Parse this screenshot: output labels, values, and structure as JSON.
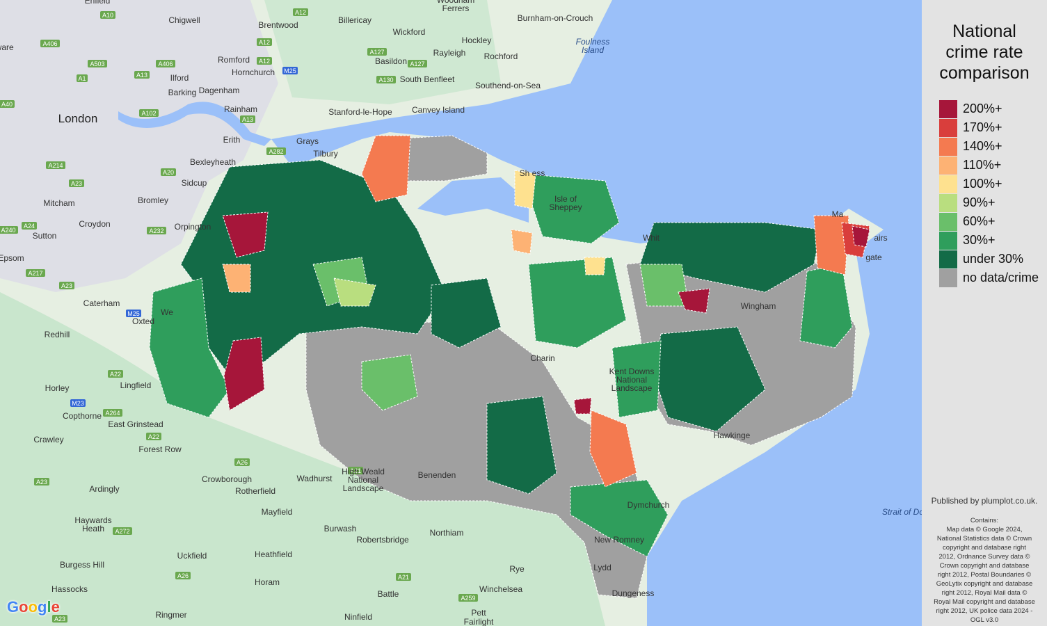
{
  "map": {
    "colors": {
      "land_base": "#e6efe2",
      "urban": "#dcdde3",
      "green_space": "#bfe2c4",
      "water": "#9bc0f9",
      "district_border": "#ffffff"
    },
    "places": [
      {
        "id": "enfield",
        "label": "Enfield"
      },
      {
        "id": "edgware",
        "label": "dgware"
      },
      {
        "id": "chigwell",
        "label": "Chigwell"
      },
      {
        "id": "brentwood",
        "label": "Brentwood"
      },
      {
        "id": "billericay",
        "label": "Billericay"
      },
      {
        "id": "wickford",
        "label": "Wickford"
      },
      {
        "id": "woodham-ferrers",
        "label": "Woodham\nFerrers"
      },
      {
        "id": "burnham",
        "label": "Burnham-on-Crouch"
      },
      {
        "id": "hockley",
        "label": "Hockley"
      },
      {
        "id": "rayleigh",
        "label": "Rayleigh"
      },
      {
        "id": "rochford",
        "label": "Rochford"
      },
      {
        "id": "foulness",
        "label": "Foulness\nIsland"
      },
      {
        "id": "romford",
        "label": "Romford"
      },
      {
        "id": "hornchurch",
        "label": "Hornchurch"
      },
      {
        "id": "basildon",
        "label": "Basildon"
      },
      {
        "id": "ilford",
        "label": "Ilford"
      },
      {
        "id": "barking",
        "label": "Barking"
      },
      {
        "id": "dagenham",
        "label": "Dagenham"
      },
      {
        "id": "south-benfleet",
        "label": "South Benfleet"
      },
      {
        "id": "southend",
        "label": "Southend-on-Sea"
      },
      {
        "id": "london",
        "label": "London"
      },
      {
        "id": "rainham",
        "label": "Rainham"
      },
      {
        "id": "stanford",
        "label": "Stanford-le-Hope"
      },
      {
        "id": "canvey",
        "label": "Canvey Island"
      },
      {
        "id": "erith",
        "label": "Erith"
      },
      {
        "id": "grays",
        "label": "Grays"
      },
      {
        "id": "tilbury",
        "label": "Tilbury"
      },
      {
        "id": "bexleyheath",
        "label": "Bexleyheath"
      },
      {
        "id": "sidcup",
        "label": "Sidcup"
      },
      {
        "id": "mitcham",
        "label": "Mitcham"
      },
      {
        "id": "bromley",
        "label": "Bromley"
      },
      {
        "id": "croydon",
        "label": "Croydon"
      },
      {
        "id": "orpington",
        "label": "Orpington"
      },
      {
        "id": "sutton",
        "label": "Sutton"
      },
      {
        "id": "epsom",
        "label": "Epsom"
      },
      {
        "id": "caterham",
        "label": "Caterham"
      },
      {
        "id": "westerham",
        "label": "We"
      },
      {
        "id": "oxted",
        "label": "Oxted"
      },
      {
        "id": "redhill",
        "label": "Redhill"
      },
      {
        "id": "horley",
        "label": "Horley"
      },
      {
        "id": "lingfield",
        "label": "Lingfield"
      },
      {
        "id": "copthorne",
        "label": "Copthorne"
      },
      {
        "id": "east-grinstead",
        "label": "East Grinstead"
      },
      {
        "id": "crawley",
        "label": "Crawley"
      },
      {
        "id": "forest-row",
        "label": "Forest Row"
      },
      {
        "id": "crowborough",
        "label": "Crowborough"
      },
      {
        "id": "wadhurst",
        "label": "Wadhurst"
      },
      {
        "id": "rotherfield",
        "label": "Rotherfield"
      },
      {
        "id": "ardingly",
        "label": "Ardingly"
      },
      {
        "id": "mayfield",
        "label": "Mayfield"
      },
      {
        "id": "haywards-heath",
        "label": "Haywards\nHeath"
      },
      {
        "id": "burwash",
        "label": "Burwash"
      },
      {
        "id": "robertsbridge",
        "label": "Robertsbridge"
      },
      {
        "id": "northiam",
        "label": "Northiam"
      },
      {
        "id": "uckfield",
        "label": "Uckfield"
      },
      {
        "id": "heathfield",
        "label": "Heathfield"
      },
      {
        "id": "burgess-hill",
        "label": "Burgess Hill"
      },
      {
        "id": "hassocks",
        "label": "Hassocks"
      },
      {
        "id": "horam",
        "label": "Horam"
      },
      {
        "id": "battle",
        "label": "Battle"
      },
      {
        "id": "rye",
        "label": "Rye"
      },
      {
        "id": "winchelsea",
        "label": "Winchelsea"
      },
      {
        "id": "ringmer",
        "label": "Ringmer"
      },
      {
        "id": "ninfield",
        "label": "Ninfield"
      },
      {
        "id": "pett",
        "label": "Pett"
      },
      {
        "id": "fairlight",
        "label": "Fairlight"
      },
      {
        "id": "lydd",
        "label": "Lydd"
      },
      {
        "id": "dungeness",
        "label": "Dungeness"
      },
      {
        "id": "new-romney",
        "label": "New Romney"
      },
      {
        "id": "dymchurch",
        "label": "Dymchurch"
      },
      {
        "id": "high-weald",
        "label": "High Weald\nNational\nLandscape"
      },
      {
        "id": "kent-downs",
        "label": "Kent Downs\nNational\nLandscape"
      },
      {
        "id": "strait",
        "label": "Strait of Do"
      },
      {
        "id": "sheerness",
        "label": "Sh    ess"
      },
      {
        "id": "isle-sheppey",
        "label": "Isle of\nSheppey"
      },
      {
        "id": "whitstable",
        "label": "Whit"
      },
      {
        "id": "margate",
        "label": "Ma"
      },
      {
        "id": "broadstairs",
        "label": "airs"
      },
      {
        "id": "ramsgate",
        "label": "gate"
      },
      {
        "id": "wingham",
        "label": "Wingham"
      },
      {
        "id": "charing",
        "label": "Charin"
      },
      {
        "id": "hawkinge",
        "label": "Hawkinge"
      },
      {
        "id": "benenden",
        "label": "Benenden"
      }
    ],
    "roads": [
      "A10",
      "A12",
      "A406",
      "A503",
      "A1",
      "A12",
      "A406",
      "A127",
      "A12",
      "M25",
      "A127",
      "A130",
      "A13",
      "A40",
      "A102",
      "A13",
      "A282",
      "A214",
      "A20",
      "A23",
      "A24",
      "A232",
      "A240",
      "A217",
      "A23",
      "M25",
      "A22",
      "M23",
      "A264",
      "A22",
      "A26",
      "A23",
      "A272",
      "A26",
      "A21",
      "A21",
      "A259",
      "A23"
    ]
  },
  "legend": {
    "title_lines": [
      "National",
      "crime rate",
      "comparison"
    ],
    "items": [
      {
        "label": "200%+",
        "color": "#a6163a"
      },
      {
        "label": "170%+",
        "color": "#d93e3c"
      },
      {
        "label": "140%+",
        "color": "#f47a50"
      },
      {
        "label": "110%+",
        "color": "#fdb274"
      },
      {
        "label": "100%+",
        "color": "#fee18f"
      },
      {
        "label": "90%+",
        "color": "#b9de7f"
      },
      {
        "label": "60%+",
        "color": "#6abf6a"
      },
      {
        "label": "30%+",
        "color": "#2f9e5c"
      },
      {
        "label": "under 30%",
        "color": "#136b47"
      },
      {
        "label": "no data/crime",
        "color": "#a0a0a0"
      }
    ]
  },
  "attribution": {
    "publisher": "Published by plumplot.co.uk.",
    "credits_lines": [
      "Contains:",
      "Map data © Google 2024,",
      "National Statistics data © Crown",
      "copyright and database right",
      "2012, Ordnance Survey data ©",
      "Crown copyright and database",
      "right 2012, Postal Boundaries ©",
      "GeoLytix copyright and database",
      "right 2012, Royal Mail data ©",
      "Royal Mail copyright and database",
      "right 2012, UK police data 2024 -",
      "OGL v3.0"
    ],
    "google_logo_text": "Google"
  }
}
